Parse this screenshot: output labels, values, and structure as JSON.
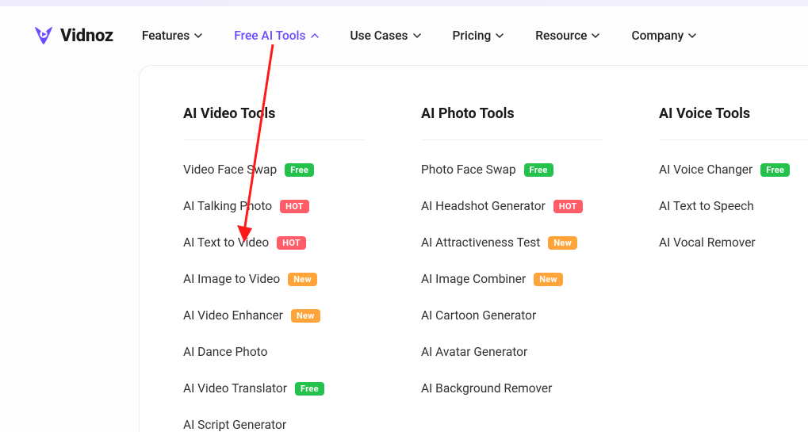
{
  "brand": {
    "name": "Vidnoz"
  },
  "nav": {
    "items": [
      {
        "label": "Features",
        "expanded": false
      },
      {
        "label": "Free AI Tools",
        "expanded": true
      },
      {
        "label": "Use Cases",
        "expanded": false
      },
      {
        "label": "Pricing",
        "expanded": false
      },
      {
        "label": "Resource",
        "expanded": false
      },
      {
        "label": "Company",
        "expanded": false
      }
    ]
  },
  "dropdown": {
    "columns": [
      {
        "title": "AI Video Tools",
        "items": [
          {
            "label": "Video Face Swap",
            "badge": "Free",
            "badge_kind": "free"
          },
          {
            "label": "AI Talking Photo",
            "badge": "HOT",
            "badge_kind": "hot"
          },
          {
            "label": "AI Text to Video",
            "badge": "HOT",
            "badge_kind": "hot"
          },
          {
            "label": "AI Image to Video",
            "badge": "New",
            "badge_kind": "new"
          },
          {
            "label": "AI Video Enhancer",
            "badge": "New",
            "badge_kind": "new"
          },
          {
            "label": "AI Dance Photo",
            "badge": null
          },
          {
            "label": "AI Video Translator",
            "badge": "Free",
            "badge_kind": "free"
          },
          {
            "label": "AI Script Generator",
            "badge": null
          }
        ]
      },
      {
        "title": "AI Photo Tools",
        "items": [
          {
            "label": "Photo Face Swap",
            "badge": "Free",
            "badge_kind": "free"
          },
          {
            "label": "AI Headshot Generator",
            "badge": "HOT",
            "badge_kind": "hot"
          },
          {
            "label": "AI Attractiveness Test",
            "badge": "New",
            "badge_kind": "new"
          },
          {
            "label": "AI Image Combiner",
            "badge": "New",
            "badge_kind": "new"
          },
          {
            "label": "AI Cartoon Generator",
            "badge": null
          },
          {
            "label": "AI Avatar Generator",
            "badge": null
          },
          {
            "label": "AI Background Remover",
            "badge": null
          }
        ]
      },
      {
        "title": "AI Voice Tools",
        "items": [
          {
            "label": "AI Voice Changer",
            "badge": "Free",
            "badge_kind": "free"
          },
          {
            "label": "AI Text to Speech",
            "badge": null
          },
          {
            "label": "AI Vocal Remover",
            "badge": null
          }
        ]
      }
    ]
  },
  "annotation": {
    "type": "arrow",
    "points_to": "AI Text to Video"
  }
}
